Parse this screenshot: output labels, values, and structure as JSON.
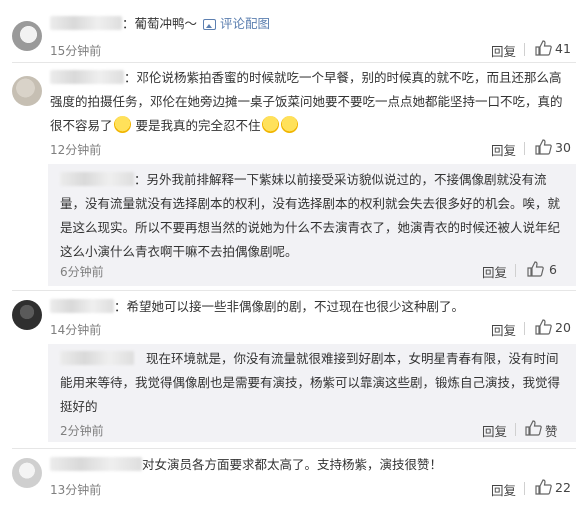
{
  "comments": [
    {
      "username": "：葡萄冲鸭～",
      "link_label": "评论配图",
      "time": "15分钟前",
      "reply_label": "回复",
      "likes": "41"
    },
    {
      "text": "：邓伦说杨紫拍香蜜的时候就吃一个早餐，别的时候真的就不吃，而且还那么高强度的拍摄任务，邓伦在她旁边摊一桌子饭菜问她要不要吃一点点她都能坚持一口不吃，真的很不容易了",
      "text_tail": "要是我真的完全忍不住",
      "time": "12分钟前",
      "reply_label": "回复",
      "likes": "30"
    },
    {
      "text": "：另外我前排解释一下紫妹以前接受采访貌似说过的，不接偶像剧就没有流量，没有流量就没有选择剧本的权利，没有选择剧本的权利就会失去很多好的机会。唉，就是这么现实。所以不要再想当然的说她为什么不去演青衣了，她演青衣的时候还被人说年纪这么小演什么青衣啊干嘛不去拍偶像剧呢。",
      "time": "6分钟前",
      "reply_label": "回复",
      "likes": "6"
    },
    {
      "text": "：希望她可以接一些非偶像剧的剧，不过现在也很少这种剧了。",
      "time": "14分钟前",
      "reply_label": "回复",
      "likes": "20"
    },
    {
      "text": "现在环境就是，你没有流量就很难接到好剧本，女明星青春有限，没有时间能用来等待，我觉得偶像剧也是需要有演技，杨紫可以靠演这些剧，锻炼自己演技，我觉得挺好的",
      "time": "2分钟前",
      "reply_label": "回复",
      "likes": "赞"
    },
    {
      "text": "对女演员各方面要求都太高了。支持杨紫，演技很赞！",
      "time": "13分钟前",
      "reply_label": "回复",
      "likes": "22"
    }
  ]
}
